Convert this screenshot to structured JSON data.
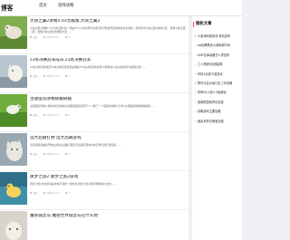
{
  "header": {
    "logo": "博客",
    "logo_sub": "sohu.com",
    "nav": [
      "首页",
      "游戏攻略"
    ]
  },
  "posts": [
    {
      "title": "大侠之翼2攻略5.03无敌版,大侠之翼2",
      "desc": "大侠之翼2攻略5.03大侠之翼2是一款由Thrive中文网平台发行的开放世界武侠角色扮演游戏，游戏支持大侠之翼2角色打造、灵根大侠之翼二转，攻略大侠之翼2的攻略方法……",
      "meta": [
        "阅读",
        "2023-01-13",
        "0"
      ]
    },
    {
      "title": "s3总决赛冠军成员,s3总决赛冠军",
      "desc": "S3总决赛冠军成员S3总决赛冠军成员是哪些?S3总决赛冠军成员S3赛季在S3总决赛冠军中战胜皇族……",
      "meta": [
        "阅读",
        "2023-01-13",
        "0"
      ]
    },
    {
      "title": "主题医院攻略秘籍秘籍",
      "desc": "主题医院攻略人类中世纪主题中主题医院医院里有不少人做了一个医院的攻略大全吗?主题医院攻略秘籍秘籍……",
      "meta": [
        "阅读",
        "2023-01-13",
        "0"
      ]
    },
    {
      "title": "远芳后期打野 远芳后期游戏",
      "desc": "远芳后期英雄最开始在游戏主英雄打野远芳后期打野的时候打野位置打野后期……",
      "meta": [
        "阅读",
        "2023-01-13",
        "0"
      ]
    },
    {
      "title": "质梦之旅2 质梦之旅2游戏",
      "desc": "质梦之旅2这款游戏是非常不错的一款游戏,质梦之旅2游戏攻略质梦之旅2……",
      "meta": [
        "阅读",
        "2023-01-13",
        "0"
      ]
    },
    {
      "title": "魔兽城堡岛 魔兽世界城堡岛在什么地",
      "desc": "",
      "meta": []
    }
  ],
  "sidebar": {
    "title": "随机文章",
    "items": [
      "小游戏网络游戏 单机游戏",
      "qq炫舞黑色公爵刷新时间",
      "DNF仓库装备怎么弄回来",
      "工人物语6全部建筑",
      "怀特2全部下载游戏",
      "野外行走大地行走工作攻略",
      "死神VS火影2.0最新版",
      "英雄联盟和梦幻西游",
      "攻略游戏主要攻略",
      "魔兽世界灵魂宝石图"
    ]
  }
}
